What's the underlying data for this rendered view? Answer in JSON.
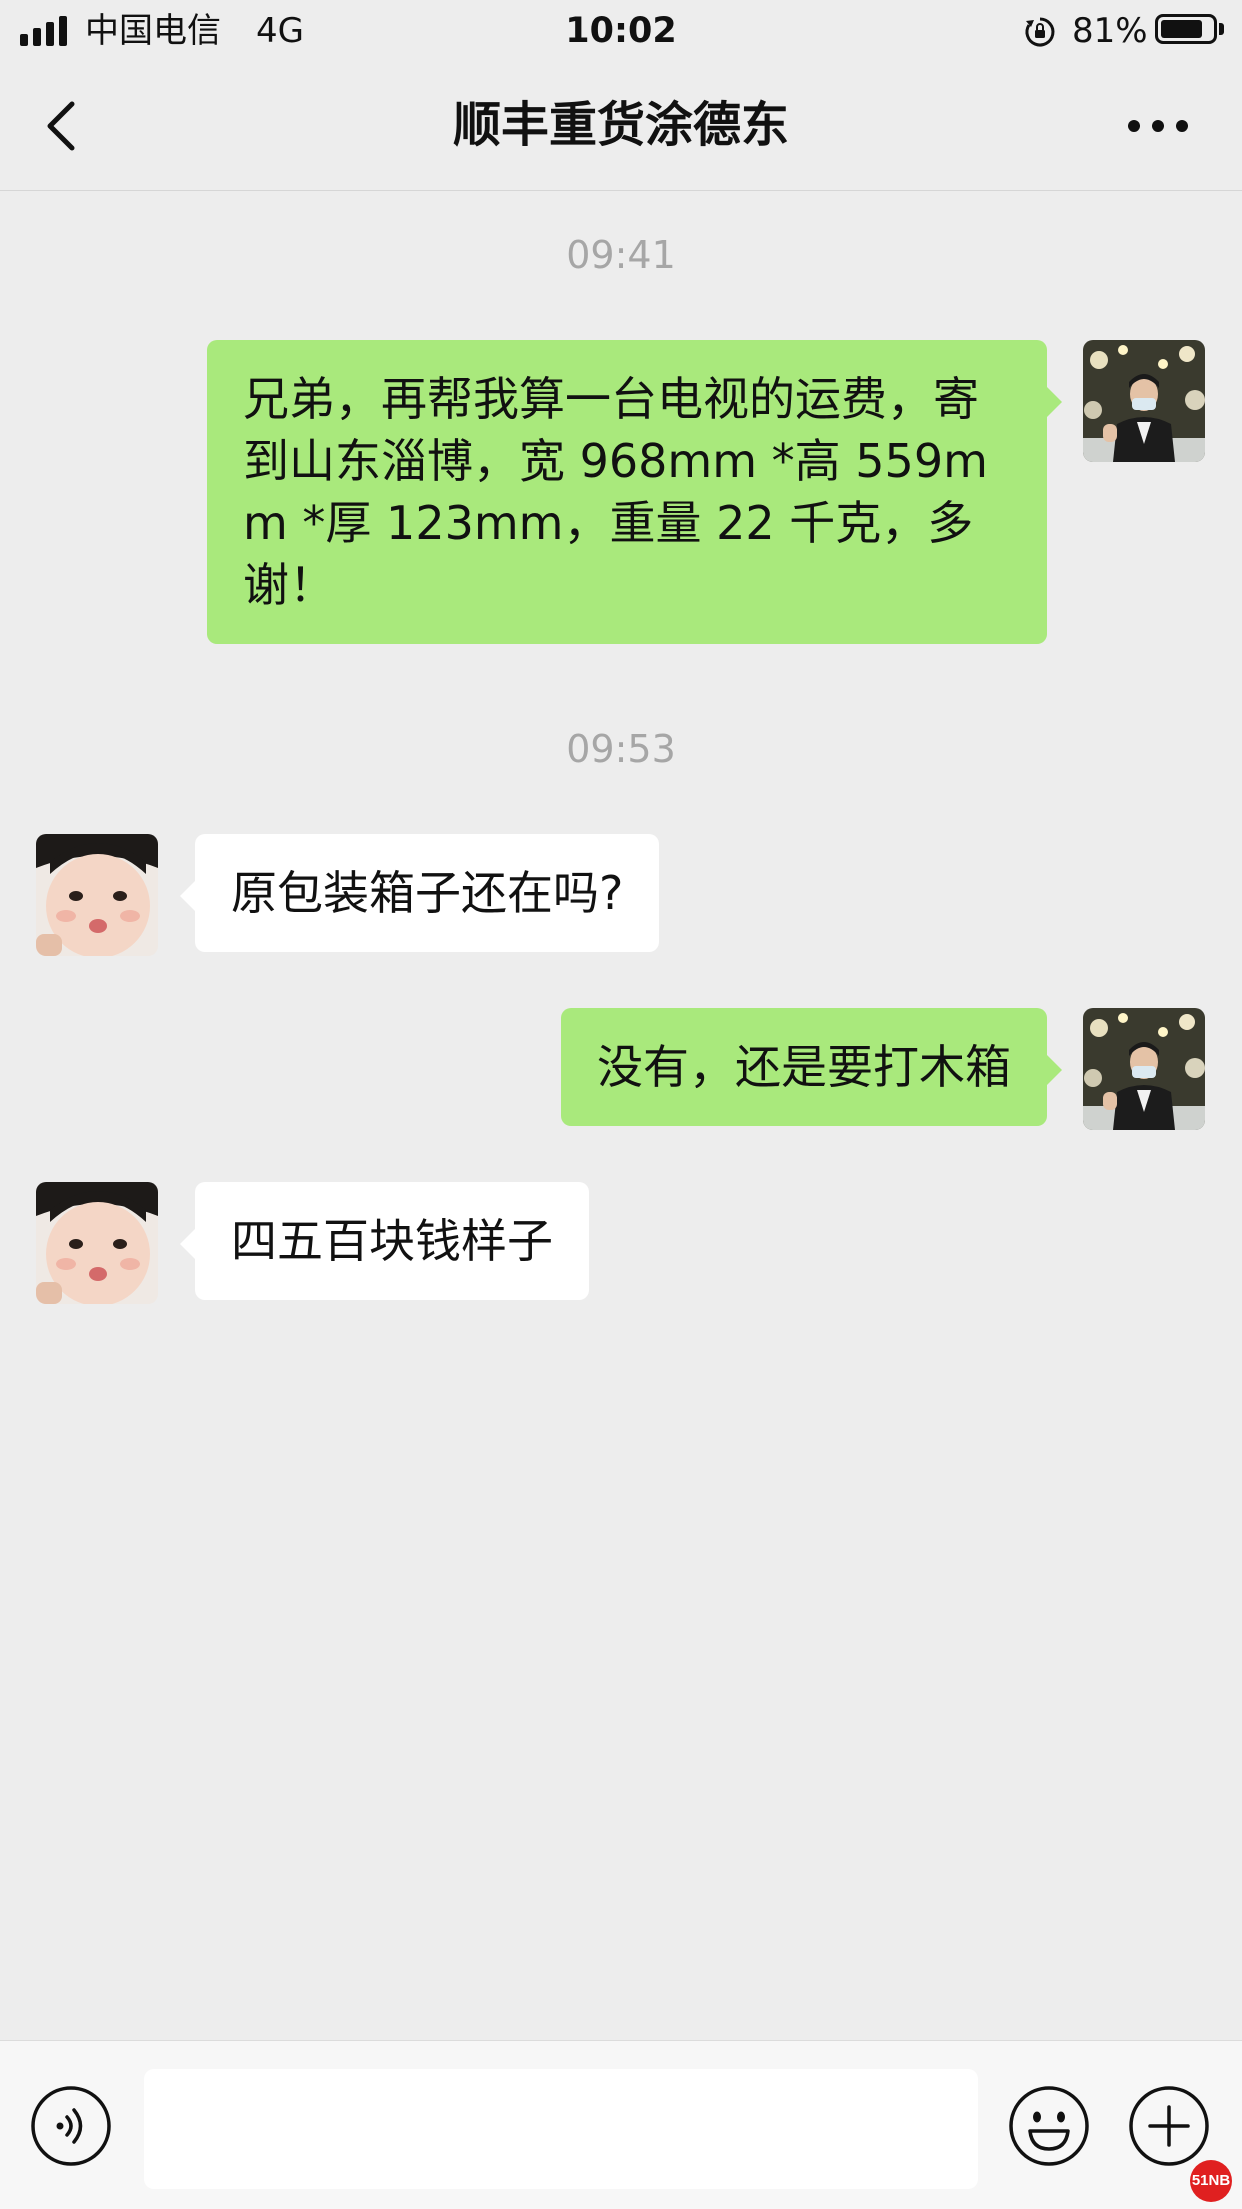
{
  "status_bar": {
    "carrier": "中国电信",
    "network": "4G",
    "time": "10:02",
    "battery_percent": "81%",
    "battery_level": 0.81,
    "orientation_lock_icon": "rotation-lock-icon"
  },
  "header": {
    "back_icon": "chevron-left-icon",
    "title": "顺丰重货涂德东",
    "more_icon": "more-dots-icon"
  },
  "messages": {
    "ts1": "09:41",
    "m1": "兄弟，再帮我算一台电视的运费，寄到山东淄博，宽 968mm *高 559mm *厚 123mm，重量 22 千克，多谢！",
    "ts2": "09:53",
    "m2": "原包装箱子还在吗?",
    "m3": "没有，还是要打木箱",
    "m4": "四五百块钱样子"
  },
  "input_bar": {
    "voice_icon": "voice-icon",
    "placeholder": "",
    "emoji_icon": "smile-icon",
    "add_icon": "plus-icon"
  },
  "watermark": "51NB",
  "colors": {
    "sent_bubble": "#a9e97c",
    "received_bubble": "#ffffff",
    "background": "#ededed"
  }
}
